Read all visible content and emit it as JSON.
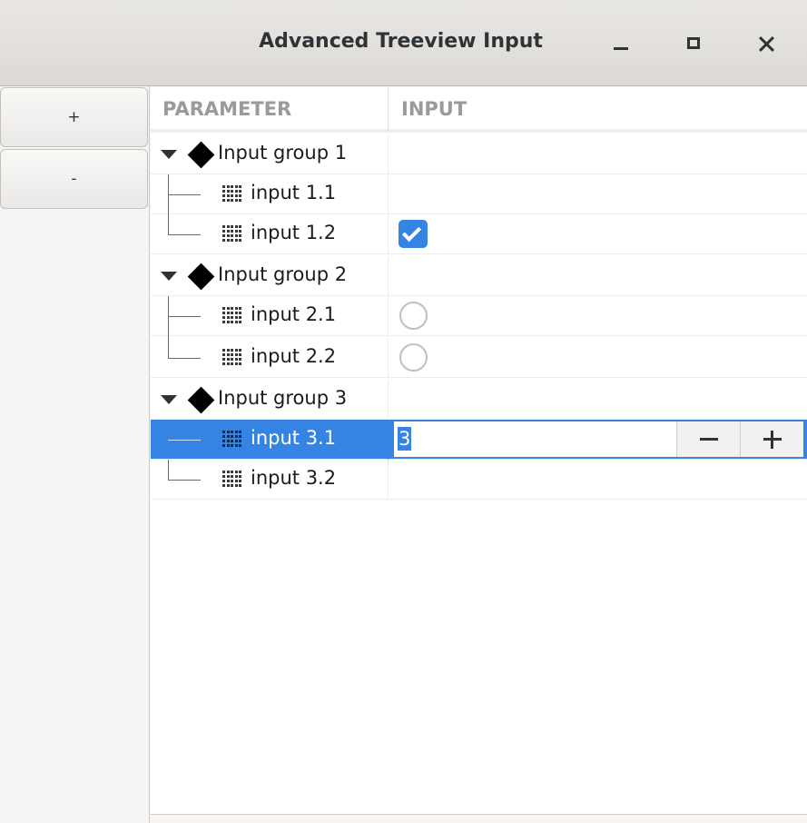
{
  "window": {
    "title": "Advanced Treeview Input",
    "controls": [
      "minimize-icon",
      "maximize-icon",
      "close-icon"
    ]
  },
  "sidebar": {
    "add_label": "+",
    "remove_label": "-"
  },
  "table": {
    "columns": [
      "PARAMETER",
      "INPUT"
    ],
    "groups": [
      {
        "label": "Input group 1",
        "items": [
          {
            "label": "input 1.1",
            "input": "none"
          },
          {
            "label": "input 1.2",
            "input": "checkbox",
            "checked": true
          }
        ]
      },
      {
        "label": "Input group 2",
        "items": [
          {
            "label": "input 2.1",
            "input": "radio",
            "checked": false
          },
          {
            "label": "input 2.2",
            "input": "radio",
            "checked": false
          }
        ]
      },
      {
        "label": "Input group 3",
        "items": [
          {
            "label": "input 3.1",
            "input": "spinner",
            "value": "3",
            "selected": true
          },
          {
            "label": "input 3.2",
            "input": "none"
          }
        ]
      }
    ]
  },
  "colors": {
    "accent": "#3584e4",
    "header_text": "#9a9a9a"
  }
}
